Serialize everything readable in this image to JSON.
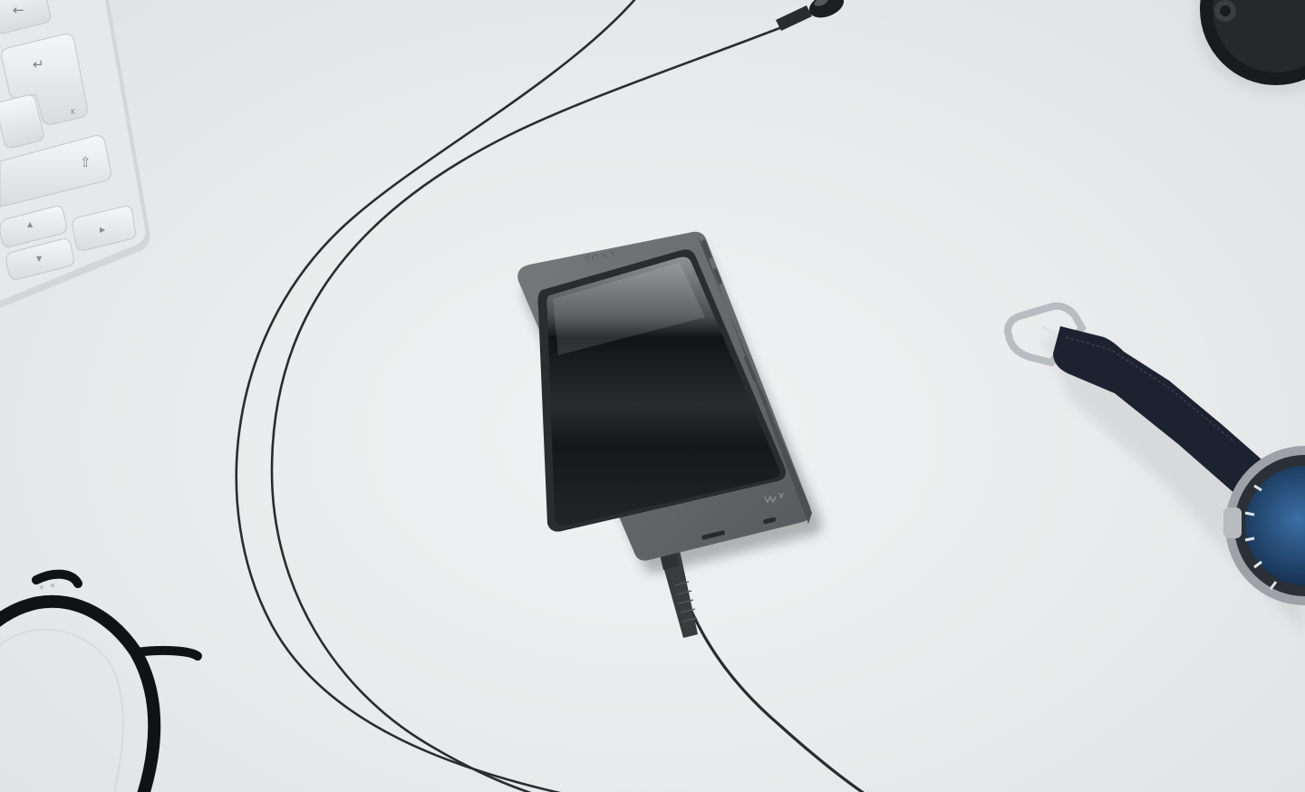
{
  "scene": {
    "background_color": "#e9ebec"
  },
  "player": {
    "brand": "SONY",
    "logo_mark": "walkman-logo",
    "body_color": "#6a6c70",
    "screen_color": "#1b1c1e"
  },
  "keyboard": {
    "keys": [
      {
        "glyph": "←",
        "icon": "backspace-arrow-icon"
      },
      {
        "glyph": "↵",
        "icon": "return-key-icon"
      },
      {
        "glyph": "K",
        "icon": "key-letter"
      },
      {
        "glyph": "⇧",
        "icon": "shift-arrow-icon"
      },
      {
        "glyph": "▲",
        "icon": "arrow-up-icon"
      },
      {
        "glyph": "▼",
        "icon": "arrow-down-icon"
      },
      {
        "glyph": "▶",
        "icon": "arrow-right-icon"
      }
    ]
  },
  "colors": {
    "cable": "#2b2c2e",
    "watch_strap": "#1c2230",
    "watch_dial": "#1f4a7a",
    "glasses_frame": "#111214",
    "lens_cap": "#1a1b1d"
  }
}
